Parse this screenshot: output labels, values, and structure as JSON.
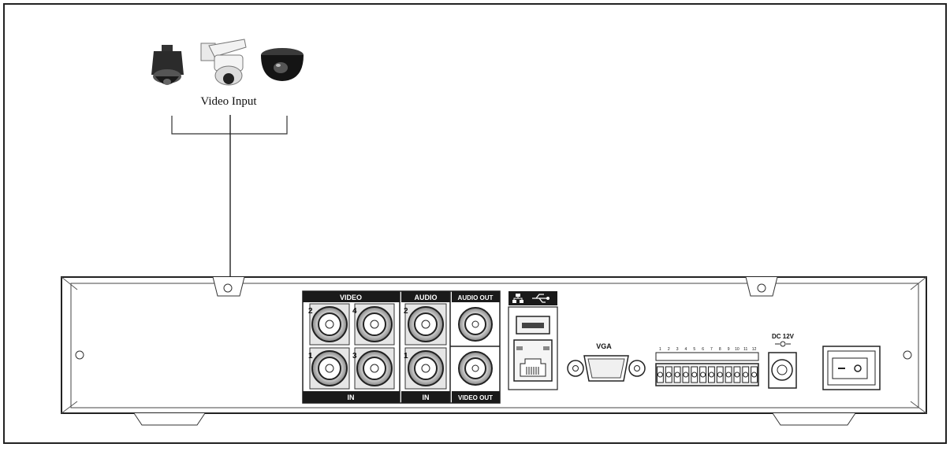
{
  "diagram": {
    "caption": "Video Input",
    "cameras": [
      {
        "kind": "pendant dome camera",
        "icon": "pendant-dome-camera-icon"
      },
      {
        "kind": "wall-mount PTZ camera",
        "icon": "ptz-camera-icon"
      },
      {
        "kind": "mini dome camera",
        "icon": "mini-dome-camera-icon"
      }
    ]
  },
  "panel": {
    "video_label": "VIDEO",
    "audio_label": "AUDIO",
    "audio_out_label": "AUDIO OUT",
    "video_out_label": "VIDEO OUT",
    "in_label_video": "IN",
    "in_label_audio": "IN",
    "vga_label": "VGA",
    "power_label": "DC 12V",
    "video_ports": [
      "2",
      "4",
      "1",
      "3"
    ],
    "audio_ports": [
      "2",
      "1"
    ],
    "terminal_labels": [
      "1",
      "2",
      "3",
      "4",
      "5",
      "6",
      "7",
      "8",
      "9",
      "10",
      "11",
      "12"
    ]
  },
  "colors": {
    "line": "#222222",
    "panel_fill": "#ffffff",
    "label_bar": "#1a1a1a",
    "label_text": "#ffffff"
  }
}
